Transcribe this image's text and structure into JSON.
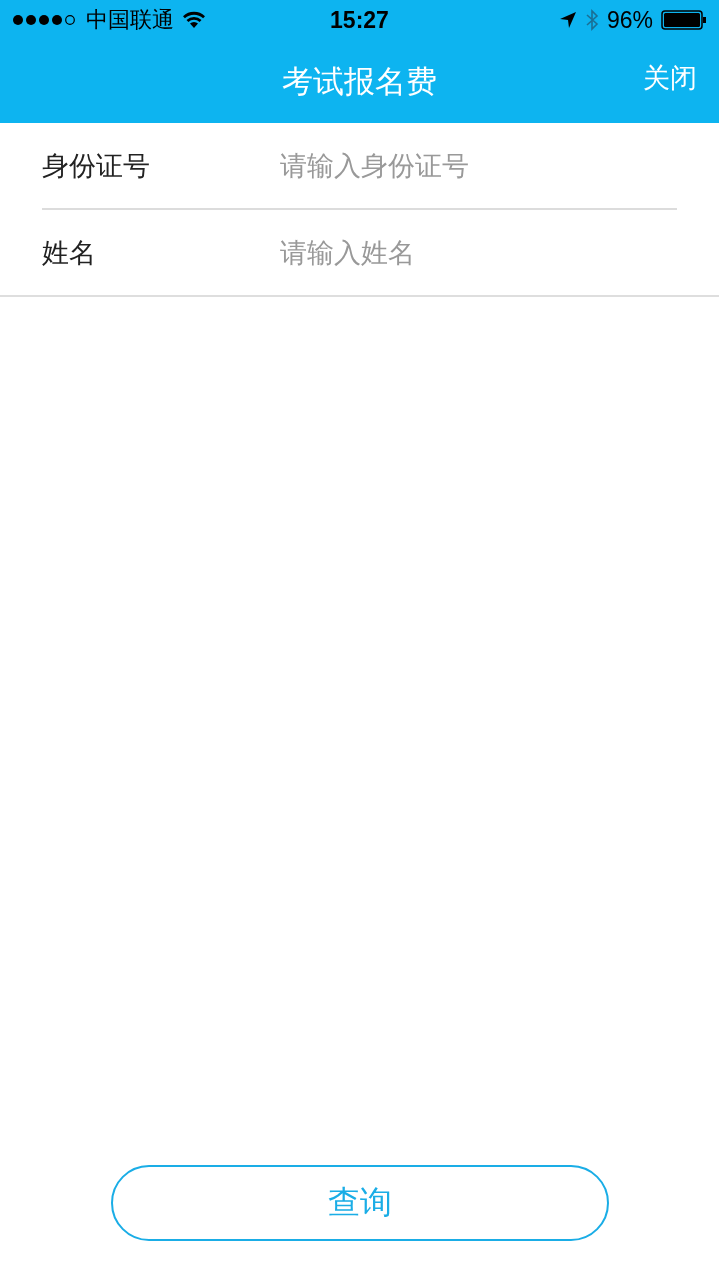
{
  "status_bar": {
    "carrier": "中国联通",
    "time": "15:27",
    "battery": "96%"
  },
  "nav_bar": {
    "title": "考试报名费",
    "close": "关闭"
  },
  "form": {
    "fields": [
      {
        "label": "身份证号",
        "placeholder": "请输入身份证号"
      },
      {
        "label": "姓名",
        "placeholder": "请输入姓名"
      }
    ]
  },
  "query_button": "查询"
}
